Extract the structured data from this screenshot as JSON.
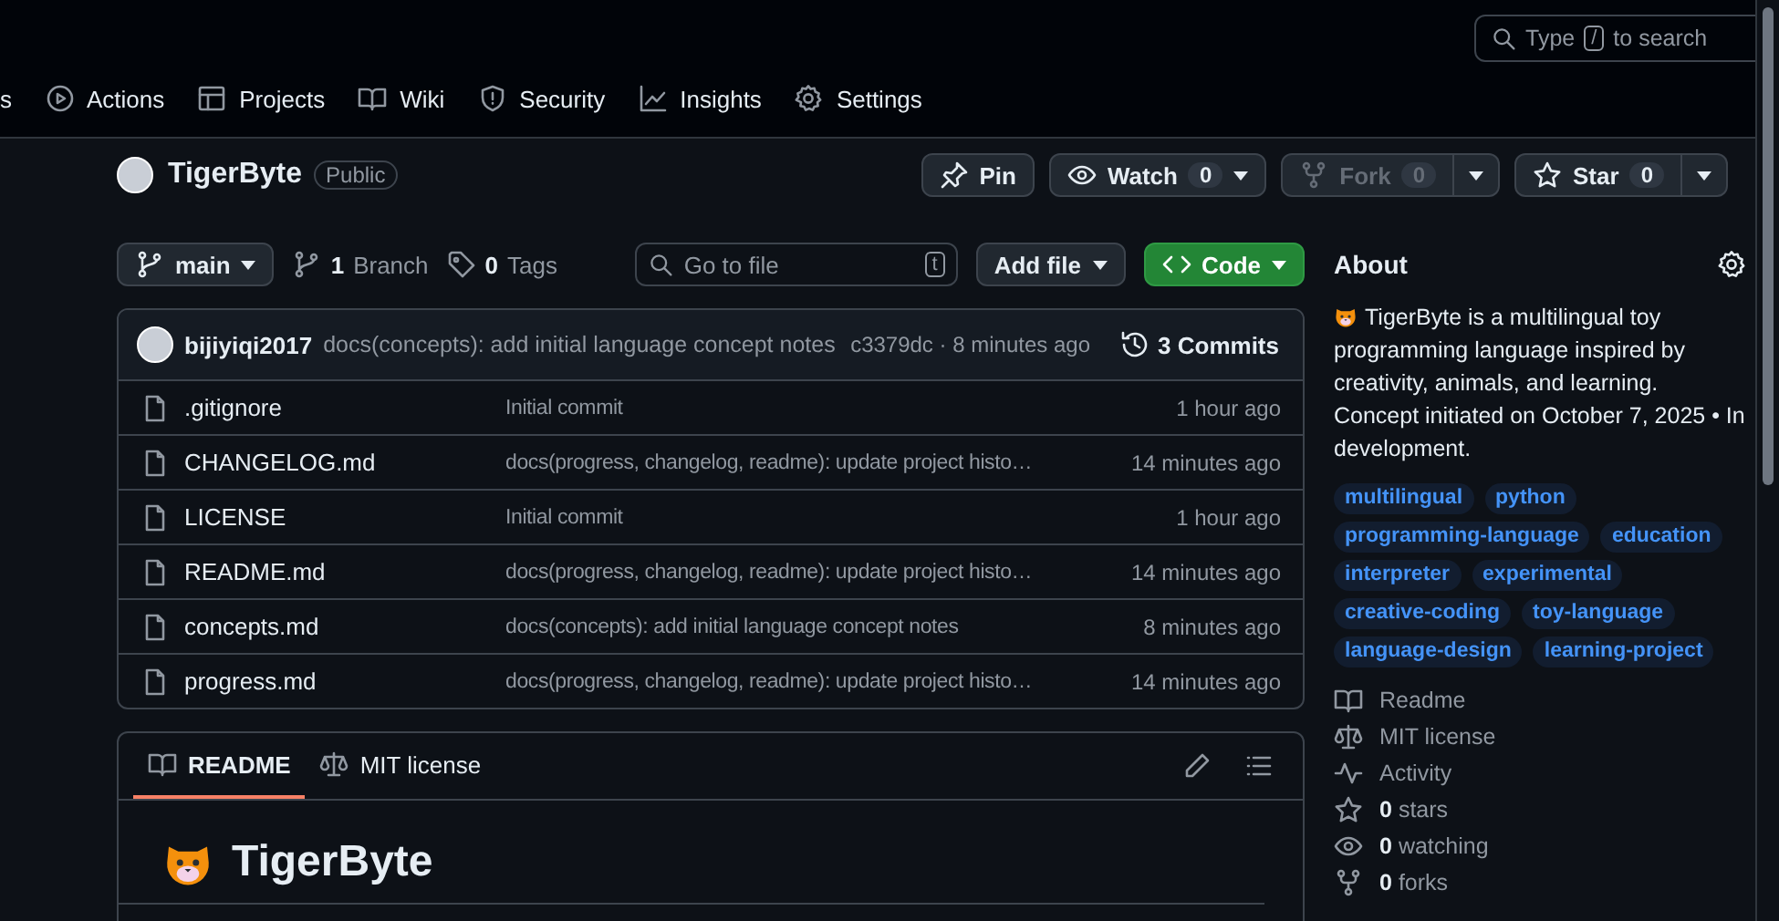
{
  "search": {
    "placeholder_before": "Type",
    "key": "/",
    "placeholder_after": "to search"
  },
  "nav": [
    {
      "label": "s",
      "selected": false
    },
    {
      "kind": "actions",
      "label": "Actions",
      "selected": false
    },
    {
      "kind": "projects",
      "label": "Projects",
      "selected": false
    },
    {
      "kind": "wiki",
      "label": "Wiki",
      "selected": false
    },
    {
      "kind": "security",
      "label": "Security",
      "selected": false
    },
    {
      "kind": "insights",
      "label": "Insights",
      "selected": false
    },
    {
      "kind": "settings",
      "label": "Settings",
      "selected": false
    }
  ],
  "repo": {
    "name": "TigerByte",
    "visibility": "Public"
  },
  "repo_actions": [
    {
      "kind": "pin",
      "label": "Pin",
      "disabled": false
    },
    {
      "kind": "watch",
      "label": "Watch",
      "count": "0",
      "disabled": false
    },
    {
      "kind": "fork",
      "label": "Fork",
      "count": "0",
      "disabled": true
    },
    {
      "kind": "star",
      "label": "Star",
      "count": "0",
      "disabled": false
    }
  ],
  "toolbar": {
    "branch": "main",
    "branches_count": "1",
    "branches_label": "Branch",
    "tags_count": "0",
    "tags_label": "Tags",
    "file_search_placeholder": "Go to file",
    "file_search_key": "t",
    "add_file": "Add file",
    "code": "Code"
  },
  "latest_commit": {
    "author": "bijiyiqi2017",
    "message": "docs(concepts): add initial language concept notes",
    "hash": "c3379dc",
    "separator": "·",
    "time": "8 minutes ago",
    "commits_count": "3",
    "commits_label": "Commits"
  },
  "files": [
    {
      "name": ".gitignore",
      "message": "Initial commit",
      "time": "1 hour ago"
    },
    {
      "name": "CHANGELOG.md",
      "message": "docs(progress, changelog, readme): update project histo…",
      "time": "14 minutes ago"
    },
    {
      "name": "LICENSE",
      "message": "Initial commit",
      "time": "1 hour ago"
    },
    {
      "name": "README.md",
      "message": "docs(progress, changelog, readme): update project histo…",
      "time": "14 minutes ago"
    },
    {
      "name": "concepts.md",
      "message": "docs(concepts): add initial language concept notes",
      "time": "8 minutes ago"
    },
    {
      "name": "progress.md",
      "message": "docs(progress, changelog, readme): update project histo…",
      "time": "14 minutes ago"
    }
  ],
  "readme_tabs": [
    {
      "kind": "readme",
      "label": "README",
      "selected": true
    },
    {
      "kind": "license",
      "label": "MIT license",
      "selected": false
    }
  ],
  "readme": {
    "heading": "TigerByte"
  },
  "about": {
    "title": "About",
    "description": "TigerByte is a multilingual toy programming language inspired by creativity, animals, and learning. Concept initiated on October 7, 2025 • In development.",
    "topics": [
      "multilingual",
      "python",
      "programming-language",
      "education",
      "interpreter",
      "experimental",
      "creative-coding",
      "toy-language",
      "language-design",
      "learning-project"
    ],
    "links": [
      {
        "kind": "readme",
        "label": "Readme"
      },
      {
        "kind": "license",
        "label": "MIT license"
      },
      {
        "kind": "activity",
        "label": "Activity"
      },
      {
        "kind": "stars",
        "count": "0",
        "label": "stars"
      },
      {
        "kind": "watching",
        "count": "0",
        "label": "watching"
      },
      {
        "kind": "forks",
        "count": "0",
        "label": "forks"
      }
    ]
  }
}
